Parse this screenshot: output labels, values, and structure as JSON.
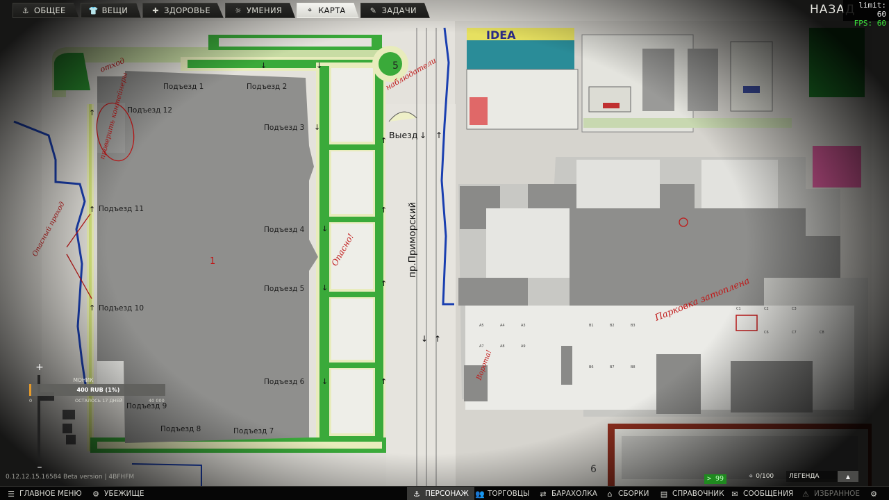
{
  "top_tabs": [
    {
      "label": "ОБЩЕЕ",
      "icon": "anchor-icon",
      "active": false
    },
    {
      "label": "ВЕЩИ",
      "icon": "shirt-icon",
      "active": false
    },
    {
      "label": "ЗДОРОВЬЕ",
      "icon": "medical-cross-icon",
      "active": false
    },
    {
      "label": "УМЕНИЯ",
      "icon": "sun-icon",
      "active": false
    },
    {
      "label": "КАРТА",
      "icon": "map-pin-icon",
      "active": true
    },
    {
      "label": "ЗАДАЧИ",
      "icon": "tasks-icon",
      "active": false
    }
  ],
  "back_label": "НАЗАД",
  "fps": {
    "limit": "limit: 60",
    "value": "FPS: 60"
  },
  "map": {
    "entrances": [
      "Подъезд 1",
      "Подъезд 2",
      "Подъезд 3",
      "Подъезд 4",
      "Подъезд 5",
      "Подъезд 6",
      "Подъезд 7",
      "Подъезд 8",
      "Подъезд 9",
      "Подъезд 10",
      "Подъезд 11",
      "Подъезд 12"
    ],
    "exit_label": "Выезд",
    "street_label": "пр.Приморский",
    "building_number": "1",
    "roundabout_number": "5",
    "bottom_number": "6",
    "store_sign": "IDEA",
    "notes": [
      "отход",
      "наблюдатели",
      "проверить контейнеры",
      "Опасно!",
      "Опасный проход",
      "Парковка затоплена",
      "Ворота!"
    ],
    "colors": {
      "paper": "#dcdcd6",
      "building": "#8e8e8c",
      "grass": "#36a836",
      "road_blue": "#1a3fb0",
      "pen_red": "#c01818"
    }
  },
  "quest": {
    "name": "МОНИК",
    "amount": "400 RUB (1%)",
    "min": "0",
    "days_left": "ОСТАЛОСЬ 17 ДНЕЙ",
    "max": "40 000",
    "progress": 0.01
  },
  "zoom": {
    "in": "+",
    "out": "–"
  },
  "version": "0.12.12.15.16584 Beta version | 4BFHFM",
  "roubles": "> 99",
  "marker_count": "0/100",
  "legend_label": "ЛЕГЕНДА",
  "bottom_nav": [
    {
      "label": "ГЛАВНОЕ МЕНЮ",
      "icon": "menu-icon",
      "active": false,
      "dim": false
    },
    {
      "label": "УБЕЖИЩЕ",
      "icon": "hideout-icon",
      "active": false,
      "dim": false
    },
    {
      "label": "ПЕРСОНАЖ",
      "icon": "anchor-icon",
      "active": true,
      "dim": false
    },
    {
      "label": "ТОРГОВЦЫ",
      "icon": "traders-icon",
      "active": false,
      "dim": false
    },
    {
      "label": "БАРАХОЛКА",
      "icon": "flea-market-icon",
      "active": false,
      "dim": false
    },
    {
      "label": "СБОРКИ",
      "icon": "builds-icon",
      "active": false,
      "dim": false
    },
    {
      "label": "СПРАВОЧНИК",
      "icon": "handbook-icon",
      "active": false,
      "dim": false
    },
    {
      "label": "СООБЩЕНИЯ",
      "icon": "messages-icon",
      "active": false,
      "dim": false
    },
    {
      "label": "ИЗБРАННОЕ",
      "icon": "favorites-icon",
      "active": false,
      "dim": true
    }
  ]
}
